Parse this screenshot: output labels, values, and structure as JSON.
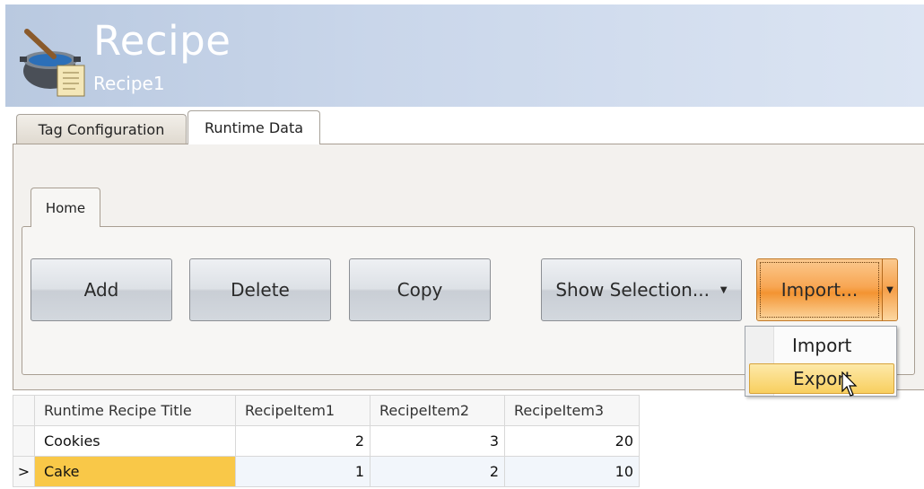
{
  "header": {
    "title": "Recipe",
    "subtitle": "Recipe1"
  },
  "tabs": [
    {
      "label": "Tag Configuration",
      "active": false
    },
    {
      "label": "Runtime Data",
      "active": true
    }
  ],
  "ribbon": {
    "tab_label": "Home",
    "buttons": {
      "add": "Add",
      "delete": "Delete",
      "copy": "Copy",
      "show_selection": "Show Selection...",
      "import": "Import..."
    }
  },
  "dropdown_menu": {
    "items": [
      "Import",
      "Export"
    ],
    "highlighted": "Export"
  },
  "grid": {
    "columns": [
      "Runtime Recipe Title",
      "RecipeItem1",
      "RecipeItem2",
      "RecipeItem3"
    ],
    "rows": [
      {
        "title": "Cookies",
        "item1": "2",
        "item2": "3",
        "item3": "20",
        "selected": false
      },
      {
        "title": "Cake",
        "item1": "1",
        "item2": "2",
        "item3": "10",
        "selected": true,
        "row_marker": ">"
      }
    ]
  },
  "colors": {
    "header_bg": "#c9d6ea",
    "hot_button": "#f39432",
    "selected_cell": "#f9c848"
  }
}
